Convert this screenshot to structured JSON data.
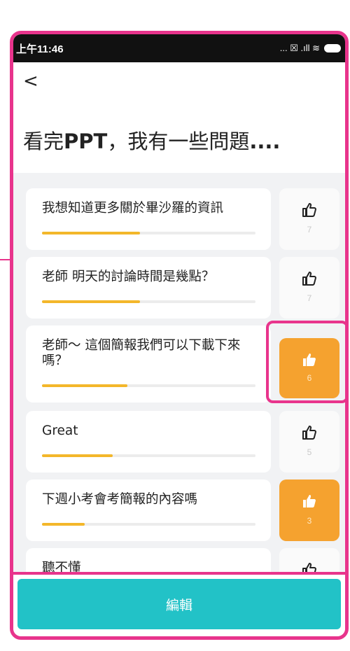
{
  "status_bar": {
    "time": "上午11:46",
    "icons": "... ☒ .ıll ≋"
  },
  "header": {
    "back_label": "<",
    "title_prefix": "看完",
    "title_bold": "PPT",
    "title_suffix": "，我有一些問題",
    "title_dots": "...."
  },
  "questions": [
    {
      "text": "我想知道更多關於畢沙羅的資訊",
      "likes": "7",
      "liked": false,
      "progress": 0.46
    },
    {
      "text": "老師 明天的討論時間是幾點？",
      "likes": "7",
      "liked": false,
      "progress": 0.46
    },
    {
      "text": "老師～ 這個簡報我們可以下載下來嗎？",
      "likes": "6",
      "liked": true,
      "progress": 0.4
    },
    {
      "text": "Great",
      "likes": "5",
      "liked": false,
      "progress": 0.33
    },
    {
      "text": "下週小考會考簡報的內容嗎",
      "likes": "3",
      "liked": true,
      "progress": 0.2
    },
    {
      "text": "聽不懂",
      "likes": "",
      "liked": false,
      "progress": 0
    }
  ],
  "bottom": {
    "edit_label": "編輯"
  },
  "colors": {
    "accent": "#22c2c7",
    "liked": "#f5a22f",
    "bar": "#f3b72a",
    "annotation": "#e8348c"
  }
}
